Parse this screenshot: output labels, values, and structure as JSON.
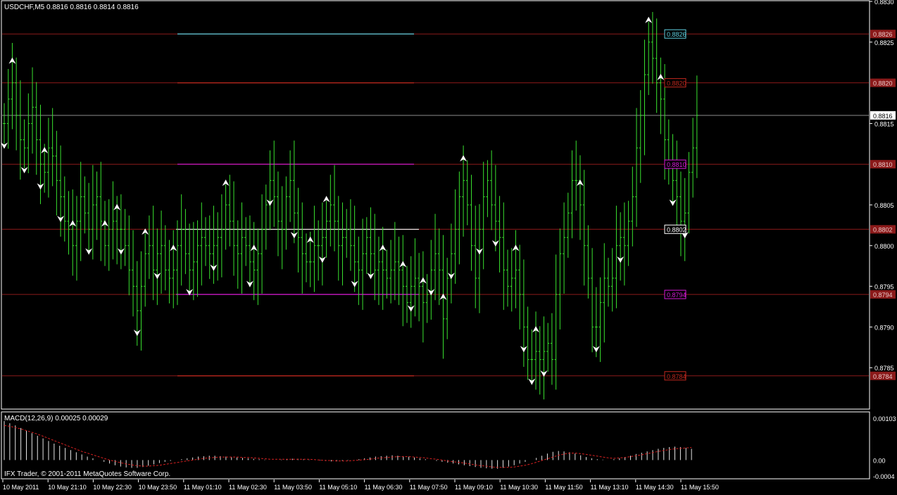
{
  "window": {
    "symbol_header": "USDCHF,M5  0.8816 0.8816 0.8814 0.8816",
    "copyright": "IFX Trader, © 2001-2011 MetaQuotes Software Corp."
  },
  "colors": {
    "background": "#000000",
    "frame": "#ffffff",
    "candle": "#39e12f",
    "level_line": "#8b1a1a",
    "bid_line": "#8c8c8c",
    "cyan_level": "#5fd0e0",
    "red_level": "#c0281e",
    "magenta_level": "#d81ad8",
    "white_level": "#ffffff",
    "macd_bar": "#e6e6e6",
    "macd_signal": "#d42020",
    "fractal_arrow": "#ffffff"
  },
  "chart_data": [
    {
      "type": "candlestick",
      "name": "USDCHF,M5",
      "ylim": [
        0.878,
        0.883
      ],
      "y_ticks": [
        "0.8830",
        "0.8825",
        "0.8815",
        "0.8805",
        "0.8800",
        "0.8795",
        "0.8790",
        "0.8785"
      ],
      "x_tick_labels": [
        "10 May 2011",
        "10 May 21:10",
        "10 May 22:30",
        "10 May 23:50",
        "11 May 01:10",
        "11 May 02:30",
        "11 May 03:50",
        "11 May 05:10",
        "11 May 06:30",
        "11 May 07:50",
        "11 May 09:10",
        "11 May 10:30",
        "11 May 11:50",
        "11 May 13:10",
        "11 May 14:30",
        "11 May 15:50"
      ],
      "current_price": "0.8816",
      "price_levels": [
        {
          "value": 0.8826,
          "label": "0.8826"
        },
        {
          "value": 0.882,
          "label": "0.8820"
        },
        {
          "value": 0.881,
          "label": "0.8810"
        },
        {
          "value": 0.8802,
          "label": "0.8802"
        },
        {
          "value": 0.8794,
          "label": "0.8794"
        },
        {
          "value": 0.8784,
          "label": "0.8784"
        }
      ],
      "level_markers": [
        {
          "value": 0.8826,
          "label": "0.8826",
          "color": "cyan"
        },
        {
          "value": 0.882,
          "label": "0.8820",
          "color": "red"
        },
        {
          "value": 0.881,
          "label": "0.8810",
          "color": "magenta"
        },
        {
          "value": 0.8802,
          "label": "0.8802",
          "color": "white"
        },
        {
          "value": 0.8794,
          "label": "0.8794",
          "color": "magenta"
        },
        {
          "value": 0.8784,
          "label": "0.8784",
          "color": "red"
        }
      ],
      "close_series": [
        0.8815,
        0.8818,
        0.882,
        0.8816,
        0.8813,
        0.8812,
        0.8815,
        0.8817,
        0.8813,
        0.881,
        0.8809,
        0.8812,
        0.8811,
        0.8808,
        0.8806,
        0.8803,
        0.8802,
        0.88,
        0.8803,
        0.8806,
        0.8804,
        0.8802,
        0.8805,
        0.8806,
        0.8803,
        0.88,
        0.8802,
        0.8803,
        0.8802,
        0.8802,
        0.88,
        0.8797,
        0.8795,
        0.8792,
        0.8795,
        0.8799,
        0.88,
        0.8797,
        0.8799,
        0.88,
        0.8797,
        0.8796,
        0.8797,
        0.88,
        0.8802,
        0.8799,
        0.8797,
        0.8798,
        0.88,
        0.8801,
        0.88,
        0.8799,
        0.88,
        0.8801,
        0.8802,
        0.8805,
        0.8803,
        0.88,
        0.8799,
        0.8801,
        0.88,
        0.8798,
        0.8797,
        0.8799,
        0.8802,
        0.8805,
        0.8808,
        0.8806,
        0.8803,
        0.8802,
        0.8806,
        0.8808,
        0.8804,
        0.8801,
        0.8799,
        0.8798,
        0.8798,
        0.88,
        0.88,
        0.8801,
        0.8803,
        0.8805,
        0.8803,
        0.88,
        0.8801,
        0.8802,
        0.88,
        0.8798,
        0.8797,
        0.8799,
        0.8801,
        0.8799,
        0.8797,
        0.8798,
        0.8797,
        0.8796,
        0.8797,
        0.8798,
        0.8797,
        0.8795,
        0.8793,
        0.8795,
        0.8796,
        0.8795,
        0.8793,
        0.8794,
        0.8797,
        0.8799,
        0.8797,
        0.8791,
        0.8796,
        0.8799,
        0.8802,
        0.8806,
        0.8808,
        0.8805,
        0.88,
        0.8796,
        0.8802,
        0.8806,
        0.8808,
        0.8805,
        0.8803,
        0.8801,
        0.8797,
        0.8795,
        0.8796,
        0.8797,
        0.8794,
        0.879,
        0.8786,
        0.8786,
        0.8787,
        0.8786,
        0.8787,
        0.8788,
        0.8786,
        0.8794,
        0.8799,
        0.8801,
        0.8804,
        0.8808,
        0.8808,
        0.8805,
        0.88,
        0.8796,
        0.879,
        0.879,
        0.8793,
        0.8796,
        0.8795,
        0.8796,
        0.88,
        0.8801,
        0.88,
        0.8803,
        0.8806,
        0.8812,
        0.8816,
        0.8821,
        0.8825,
        0.8823,
        0.882,
        0.8818,
        0.8813,
        0.881,
        0.8808,
        0.8806,
        0.8803,
        0.8804,
        0.8809,
        0.8812,
        0.8816
      ],
      "fractal_up_indices": [
        2,
        10,
        17,
        25,
        28,
        35,
        42,
        55,
        62,
        76,
        80,
        94,
        99,
        104,
        109,
        114,
        127,
        132,
        143,
        160,
        163
      ],
      "fractal_down_indices": [
        0,
        5,
        9,
        14,
        21,
        29,
        33,
        38,
        46,
        52,
        61,
        66,
        72,
        79,
        87,
        91,
        101,
        106,
        111,
        118,
        122,
        129,
        131,
        134,
        147,
        153,
        166,
        169
      ]
    },
    {
      "type": "histogram",
      "name": "MACD(12,26,9)",
      "header": "MACD(12,26,9) 0.00025 0.00029",
      "y_ticks": [
        "0.00103",
        "0.00",
        "-0.0004"
      ],
      "ylim": [
        -0.0004,
        0.00103
      ],
      "histogram": [
        0.0009,
        0.00085,
        0.0008,
        0.00074,
        0.00068,
        0.00062,
        0.00056,
        0.0005,
        0.00044,
        0.00038,
        0.00033,
        0.00028,
        0.00023,
        0.00018,
        0.00013,
        8e-05,
        4e-05,
        0.0,
        -4e-05,
        -8e-05,
        -0.00012,
        -0.00015,
        -0.00017,
        -0.00018,
        -0.00018,
        -0.00016,
        -0.00013,
        -0.0001,
        -7e-05,
        -4e-05,
        -2e-05,
        0.0,
        2e-05,
        4e-05,
        6e-05,
        8e-05,
        9e-05,
        0.0001,
        0.0001,
        9e-05,
        8e-05,
        7e-05,
        6e-05,
        5e-05,
        4e-05,
        3e-05,
        2e-05,
        1e-05,
        0.0,
        0.0,
        1e-05,
        2e-05,
        3e-05,
        3e-05,
        2e-05,
        1e-05,
        0.0,
        -1e-05,
        -2e-05,
        -3e-05,
        -3e-05,
        -2e-05,
        -1e-05,
        0.0,
        2e-05,
        4e-05,
        6e-05,
        8e-05,
        9e-05,
        0.0001,
        0.00011,
        0.0001,
        9e-05,
        8e-05,
        6e-05,
        4e-05,
        2e-05,
        0.0,
        -2e-05,
        -4e-05,
        -6e-05,
        -8e-05,
        -0.0001,
        -0.00012,
        -0.00014,
        -0.00016,
        -0.00018,
        -0.00019,
        -0.0002,
        -0.0002,
        -0.00018,
        -0.00015,
        -0.00012,
        -8e-05,
        -4e-05,
        0.0,
        5e-05,
        0.0001,
        0.00015,
        0.00019,
        0.00021,
        0.0002,
        0.00018,
        0.00015,
        0.00011,
        7e-05,
        4e-05,
        2e-05,
        1e-05,
        0.0,
        2e-05,
        4e-05,
        7e-05,
        0.0001,
        0.00014,
        0.00017,
        0.0002,
        0.00023,
        0.00026,
        0.00028,
        0.0003,
        0.00031,
        0.0003,
        0.00028,
        0.00026
      ],
      "signal": [
        0.0008,
        0.00078,
        0.00075,
        0.00072,
        0.00068,
        0.00064,
        0.0006,
        0.00055,
        0.0005,
        0.00045,
        0.0004,
        0.00035,
        0.0003,
        0.00025,
        0.0002,
        0.00016,
        0.00012,
        8e-05,
        4e-05,
        0.0,
        -3e-05,
        -6e-05,
        -9e-05,
        -0.00011,
        -0.00013,
        -0.00014,
        -0.00014,
        -0.00013,
        -0.00012,
        -0.0001,
        -8e-05,
        -6e-05,
        -4e-05,
        -2e-05,
        0.0,
        2e-05,
        4e-05,
        5e-05,
        6e-05,
        7e-05,
        7e-05,
        7e-05,
        7e-05,
        6e-05,
        6e-05,
        5e-05,
        4e-05,
        3e-05,
        2e-05,
        2e-05,
        2e-05,
        2e-05,
        2e-05,
        2e-05,
        2e-05,
        2e-05,
        1e-05,
        0.0,
        -1e-05,
        -1e-05,
        -2e-05,
        -2e-05,
        -2e-05,
        -1e-05,
        0.0,
        1e-05,
        2e-05,
        4e-05,
        5e-05,
        6e-05,
        7e-05,
        8e-05,
        8e-05,
        8e-05,
        7e-05,
        6e-05,
        5e-05,
        3e-05,
        2e-05,
        0.0,
        -2e-05,
        -4e-05,
        -5e-05,
        -7e-05,
        -9e-05,
        -0.00011,
        -0.00013,
        -0.00014,
        -0.00016,
        -0.00017,
        -0.00017,
        -0.00017,
        -0.00016,
        -0.00014,
        -0.00012,
        -9e-05,
        -5e-05,
        -1e-05,
        3e-05,
        7e-05,
        0.00011,
        0.00014,
        0.00016,
        0.00016,
        0.00015,
        0.00013,
        0.00011,
        9e-05,
        7e-05,
        5e-05,
        4e-05,
        5e-05,
        6e-05,
        8e-05,
        0.0001,
        0.00012,
        0.00015,
        0.00017,
        0.0002,
        0.00022,
        0.00024,
        0.00026,
        0.00027,
        0.00028,
        0.00029
      ]
    }
  ]
}
